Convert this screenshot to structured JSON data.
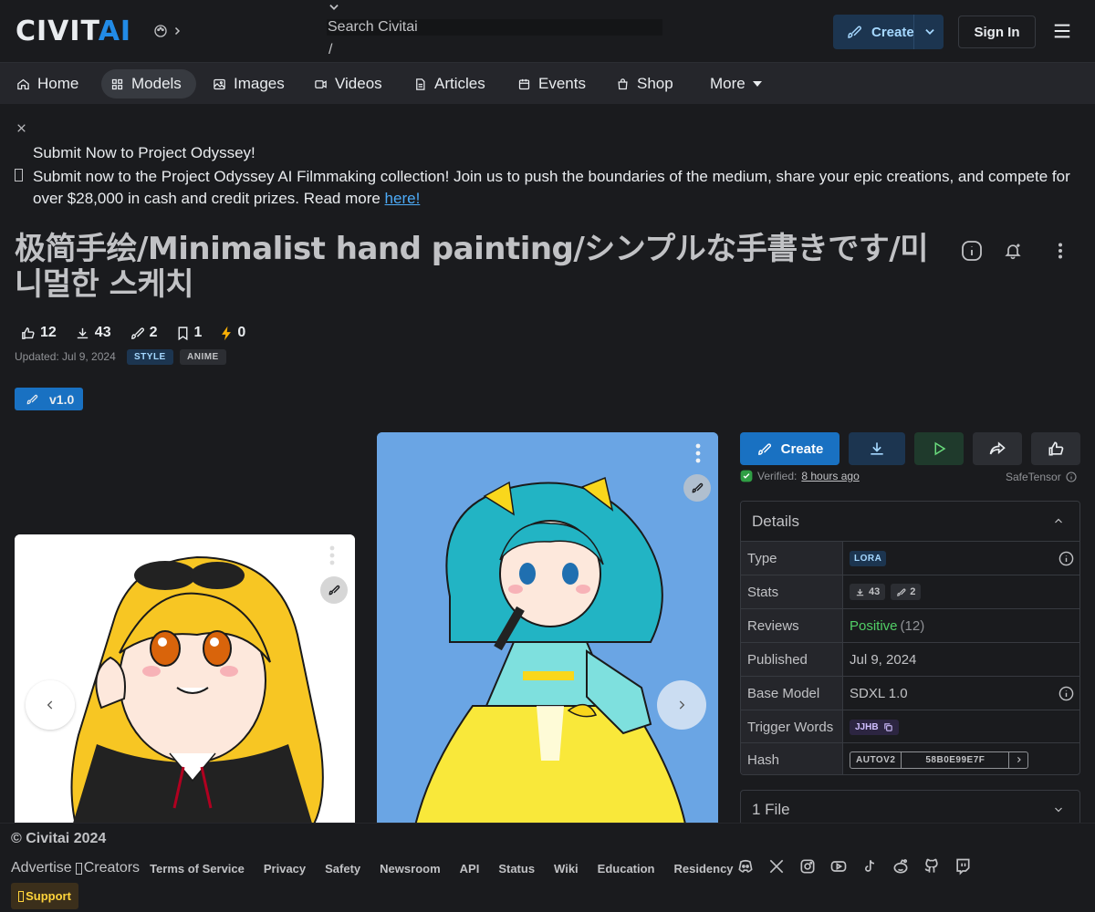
{
  "header": {
    "logo_main": "CIVIT",
    "logo_ai": "AI",
    "search_placeholder": "Search Civitai",
    "search_slash": "/",
    "create_label": "Create",
    "signin_label": "Sign In"
  },
  "nav": {
    "items": [
      {
        "label": "Home",
        "icon": "home-icon"
      },
      {
        "label": "Models",
        "icon": "grid-icon"
      },
      {
        "label": "Images",
        "icon": "photo-icon"
      },
      {
        "label": "Videos",
        "icon": "video-icon"
      },
      {
        "label": "Articles",
        "icon": "file-text-icon"
      },
      {
        "label": "Events",
        "icon": "calendar-icon"
      },
      {
        "label": "Shop",
        "icon": "shopping-bag-icon"
      }
    ],
    "more_label": "More",
    "active": "Models"
  },
  "banner": {
    "title": "Submit Now to Project Odyssey!",
    "text": "Submit now to the Project Odyssey AI Filmmaking collection! Join us to push the boundaries of the medium, share your epic creations, and compete for over $28,000 in cash and credit prizes. Read more ",
    "link": "here!"
  },
  "model": {
    "title": "极简手绘/Minimalist hand painting/シンプルな手書きです/미니멀한 스케치",
    "stats": {
      "likes": "12",
      "downloads": "43",
      "remixes": "2",
      "bookmarks": "1",
      "buzz": "0"
    },
    "updated": "Updated: Jul 9, 2024",
    "tags": [
      "STYLE",
      "ANIME"
    ],
    "version": "v1.0"
  },
  "panel": {
    "create_label": "Create",
    "verified_label": "Verified:",
    "verified_when": "8 hours ago",
    "safetensor": "SafeTensor",
    "details_title": "Details",
    "rows": {
      "type_key": "Type",
      "type_val": "LORA",
      "stats_key": "Stats",
      "stats_downloads": "43",
      "stats_remixes": "2",
      "reviews_key": "Reviews",
      "reviews_val": "Positive",
      "reviews_count": "(12)",
      "published_key": "Published",
      "published_val": "Jul 9, 2024",
      "base_key": "Base Model",
      "base_val": "SDXL 1.0",
      "trigger_key": "Trigger Words",
      "trigger_val": "JJHB",
      "hash_key": "Hash",
      "hash_type": "AUTOV2",
      "hash_val": "58B0E99E7F"
    },
    "files_title": "1 File"
  },
  "footer": {
    "copyright": "© Civitai 2024",
    "advertise": "Advertise",
    "creators": "Creators",
    "links": [
      "Terms of Service",
      "Privacy",
      "Safety",
      "Newsroom",
      "API",
      "Status",
      "Wiki",
      "Education",
      "Residency"
    ],
    "support": "Support"
  },
  "colors": {
    "background": "#1a1b1e",
    "nav_bg": "#25262b",
    "accent_blue": "#1971c2",
    "positive_green": "#51cf66"
  }
}
